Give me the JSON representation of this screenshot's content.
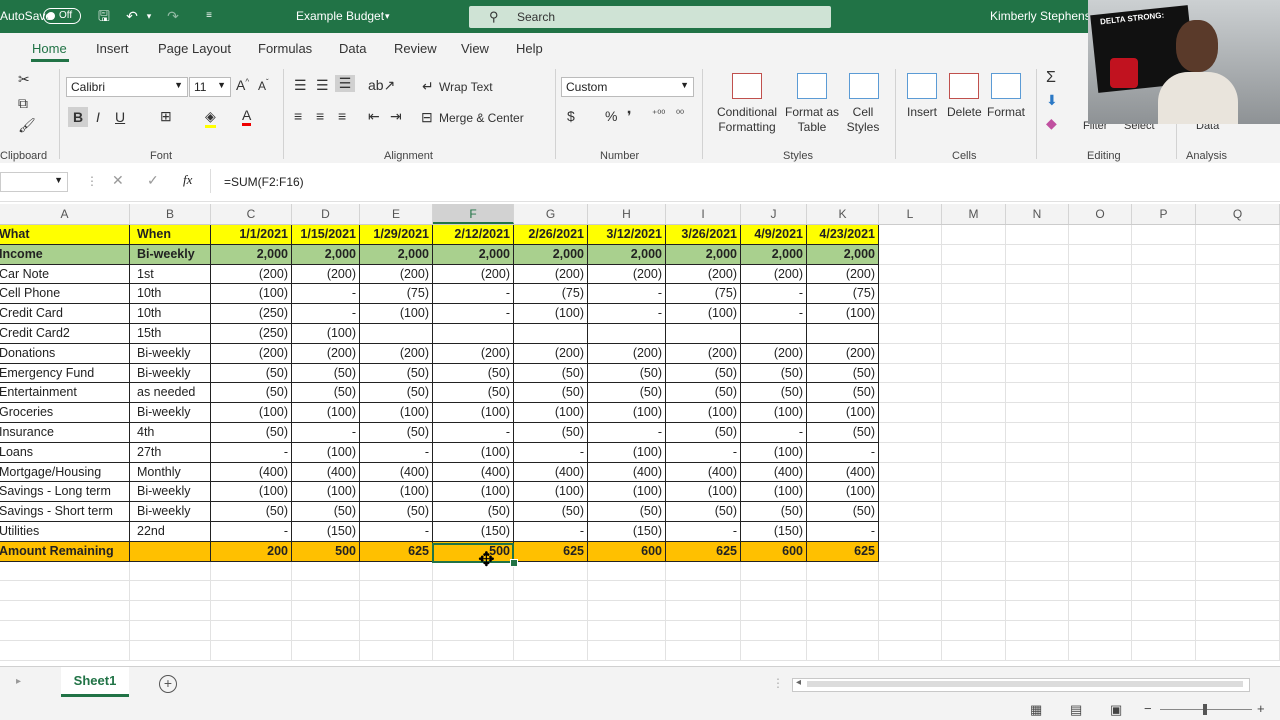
{
  "titlebar": {
    "autosave_label": "AutoSave",
    "autosave_state": "Off",
    "doc_title": "Example Budget",
    "search_placeholder": "Search",
    "user_name": "Kimberly Stephens"
  },
  "menu_tabs": [
    "Home",
    "Insert",
    "Page Layout",
    "Formulas",
    "Data",
    "Review",
    "View",
    "Help"
  ],
  "ribbon": {
    "clipboard_label": "Clipboard",
    "font_label": "Font",
    "font_name": "Calibri",
    "font_size": "11",
    "alignment_label": "Alignment",
    "wrap_text": "Wrap Text",
    "merge_center": "Merge & Center",
    "number_label": "Number",
    "number_format": "Custom",
    "styles_label": "Styles",
    "conditional_formatting": "Conditional Formatting",
    "format_as_table": "Format as Table",
    "cell_styles": "Cell Styles",
    "cells_label": "Cells",
    "insert": "Insert",
    "delete": "Delete",
    "format": "Format",
    "editing_label": "Editing",
    "filter": "Filter",
    "select": "Select",
    "analysis_label": "Analysis",
    "analyze_data": "Data"
  },
  "formula_bar": {
    "formula": "=SUM(F2:F16)"
  },
  "columns": [
    "A",
    "B",
    "C",
    "D",
    "E",
    "F",
    "G",
    "H",
    "I",
    "J",
    "K",
    "L",
    "M",
    "N",
    "O",
    "P",
    "Q"
  ],
  "selected_column": "F",
  "table": {
    "header": [
      "What",
      "When",
      "1/1/2021",
      "1/15/2021",
      "1/29/2021",
      "2/12/2021",
      "2/26/2021",
      "3/12/2021",
      "3/26/2021",
      "4/9/2021",
      "4/23/2021"
    ],
    "income": [
      "Income",
      "Bi-weekly",
      "2,000",
      "2,000",
      "2,000",
      "2,000",
      "2,000",
      "2,000",
      "2,000",
      "2,000",
      "2,000"
    ],
    "expenses": [
      [
        "Car Note",
        "1st",
        "(200)",
        "(200)",
        "(200)",
        "(200)",
        "(200)",
        "(200)",
        "(200)",
        "(200)",
        "(200)"
      ],
      [
        "Cell Phone",
        "10th",
        "(100)",
        "-",
        "(75)",
        "-",
        "(75)",
        "-",
        "(75)",
        "-",
        "(75)"
      ],
      [
        "Credit Card",
        "10th",
        "(250)",
        "-",
        "(100)",
        "-",
        "(100)",
        "-",
        "(100)",
        "-",
        "(100)"
      ],
      [
        "Credit Card2",
        "15th",
        "(250)",
        "(100)",
        "",
        "",
        "",
        "",
        "",
        "",
        ""
      ],
      [
        "Donations",
        "Bi-weekly",
        "(200)",
        "(200)",
        "(200)",
        "(200)",
        "(200)",
        "(200)",
        "(200)",
        "(200)",
        "(200)"
      ],
      [
        "Emergency Fund",
        "Bi-weekly",
        "(50)",
        "(50)",
        "(50)",
        "(50)",
        "(50)",
        "(50)",
        "(50)",
        "(50)",
        "(50)"
      ],
      [
        "Entertainment",
        "as needed",
        "(50)",
        "(50)",
        "(50)",
        "(50)",
        "(50)",
        "(50)",
        "(50)",
        "(50)",
        "(50)"
      ],
      [
        "Groceries",
        "Bi-weekly",
        "(100)",
        "(100)",
        "(100)",
        "(100)",
        "(100)",
        "(100)",
        "(100)",
        "(100)",
        "(100)"
      ],
      [
        "Insurance",
        "4th",
        "(50)",
        "-",
        "(50)",
        "-",
        "(50)",
        "-",
        "(50)",
        "-",
        "(50)"
      ],
      [
        "Loans",
        "27th",
        "-",
        "(100)",
        "-",
        "(100)",
        "-",
        "(100)",
        "-",
        "(100)",
        "-"
      ],
      [
        "Mortgage/Housing",
        "Monthly",
        "(400)",
        "(400)",
        "(400)",
        "(400)",
        "(400)",
        "(400)",
        "(400)",
        "(400)",
        "(400)"
      ],
      [
        "Savings - Long term",
        "Bi-weekly",
        "(100)",
        "(100)",
        "(100)",
        "(100)",
        "(100)",
        "(100)",
        "(100)",
        "(100)",
        "(100)"
      ],
      [
        "Savings - Short term",
        "Bi-weekly",
        "(50)",
        "(50)",
        "(50)",
        "(50)",
        "(50)",
        "(50)",
        "(50)",
        "(50)",
        "(50)"
      ],
      [
        "Utilities",
        "22nd",
        "-",
        "(150)",
        "-",
        "(150)",
        "-",
        "(150)",
        "-",
        "(150)",
        "-"
      ]
    ],
    "total": [
      "Amount Remaining",
      "",
      "200",
      "500",
      "625",
      "500",
      "625",
      "600",
      "625",
      "600",
      "625"
    ]
  },
  "sheet_tab": "Sheet1",
  "colors": {
    "excel_green": "#217346",
    "header_yellow": "#ffff00",
    "income_green": "#a9d08e",
    "total_orange": "#ffc000"
  },
  "webcam": {
    "banner_text": "DELTA STRONG:"
  }
}
